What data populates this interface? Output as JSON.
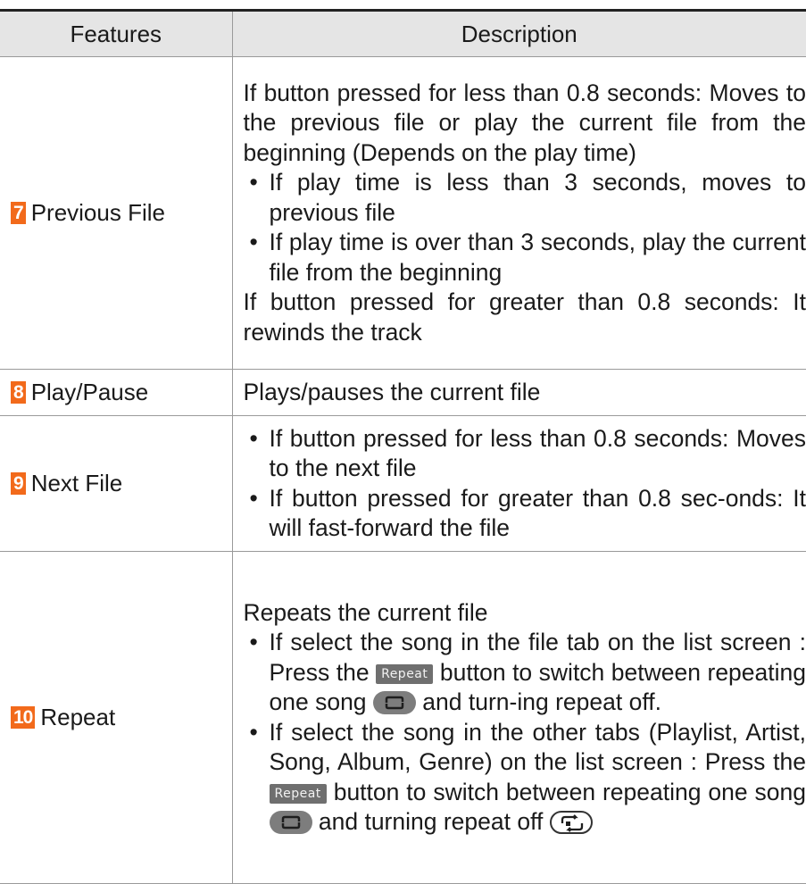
{
  "header": {
    "features": "Features",
    "description": "Description"
  },
  "rows": [
    {
      "number": "7",
      "feature": "Previous File",
      "intro": "If button pressed for less than 0.8 seconds: Moves to the previous file or play the current file from the beginning (Depends on the play time)",
      "bullets": [
        "If play time is less than 3 seconds, moves to previous file",
        "If play time is over than 3 seconds, play the current file from the beginning"
      ],
      "outro": "If button pressed for greater than 0.8 seconds: It rewinds the track"
    },
    {
      "number": "8",
      "feature": "Play/Pause",
      "intro": "Plays/pauses the current file"
    },
    {
      "number": "9",
      "feature": "Next File",
      "bullets": [
        "If button pressed for less than 0.8 seconds: Moves to the next file",
        "If button pressed for greater than 0.8 sec-onds: It will fast-forward the file"
      ]
    },
    {
      "number": "10",
      "feature": "Repeat",
      "intro": "Repeats the current file",
      "bullet1": {
        "a": "If select the song in the file tab on the list screen : Press the",
        "b": "button to switch between repeating one song",
        "c": "and turn-ing repeat off."
      },
      "bullet2": {
        "a": "If select the song in the other tabs (Playlist, Artist, Song, Album, Genre) on the list screen : Press the",
        "b": "button to switch between repeating one song",
        "c": "and turning repeat off"
      },
      "button_label": "Repeat",
      "icons": {
        "repeat_one": "repeat-one-icon",
        "repeat_off": "repeat-off-icon"
      }
    }
  ],
  "colors": {
    "number_badge": "#f26a1b",
    "header_bg": "#e5e5e5",
    "repeat_button_bg": "#6f6f6f"
  }
}
